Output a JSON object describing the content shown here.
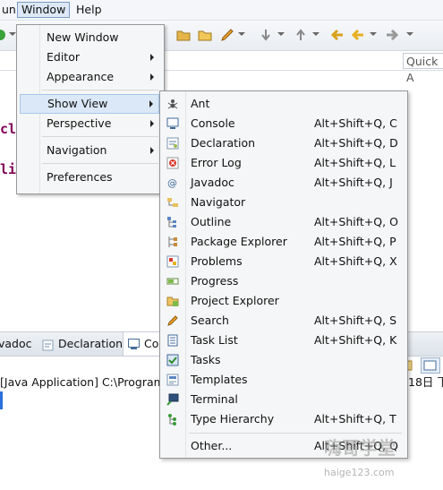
{
  "menubar": {
    "run_label": "un",
    "window_label": "Window",
    "help_label": "Help"
  },
  "toolbar": {
    "quick_access": "Quick A"
  },
  "editor": {
    "code_line1": "cl",
    "code_line2": "li"
  },
  "views": {
    "tab_javadoc": "vadoc",
    "tab_declaration": "Declaration",
    "tab_console": "Co",
    "console_text": "[Java Application] C:\\Program",
    "console_date": "18日 下"
  },
  "window_menu": {
    "items": [
      {
        "label": "New Window"
      },
      {
        "label": "Editor"
      },
      {
        "label": "Appearance"
      },
      {
        "label": "Show View"
      },
      {
        "label": "Perspective"
      },
      {
        "label": "Navigation"
      },
      {
        "label": "Preferences"
      }
    ]
  },
  "show_view_menu": {
    "items": [
      {
        "label": "Ant",
        "shortcut": "",
        "icon": "ant-icon"
      },
      {
        "label": "Console",
        "shortcut": "Alt+Shift+Q, C",
        "icon": "console-icon"
      },
      {
        "label": "Declaration",
        "shortcut": "Alt+Shift+Q, D",
        "icon": "declaration-icon"
      },
      {
        "label": "Error Log",
        "shortcut": "Alt+Shift+Q, L",
        "icon": "error-log-icon"
      },
      {
        "label": "Javadoc",
        "shortcut": "Alt+Shift+Q, J",
        "icon": "javadoc-icon"
      },
      {
        "label": "Navigator",
        "shortcut": "",
        "icon": "navigator-icon"
      },
      {
        "label": "Outline",
        "shortcut": "Alt+Shift+Q, O",
        "icon": "outline-icon"
      },
      {
        "label": "Package Explorer",
        "shortcut": "Alt+Shift+Q, P",
        "icon": "package-explorer-icon"
      },
      {
        "label": "Problems",
        "shortcut": "Alt+Shift+Q, X",
        "icon": "problems-icon"
      },
      {
        "label": "Progress",
        "shortcut": "",
        "icon": "progress-icon"
      },
      {
        "label": "Project Explorer",
        "shortcut": "",
        "icon": "project-explorer-icon"
      },
      {
        "label": "Search",
        "shortcut": "Alt+Shift+Q, S",
        "icon": "search-icon"
      },
      {
        "label": "Task List",
        "shortcut": "Alt+Shift+Q, K",
        "icon": "task-list-icon"
      },
      {
        "label": "Tasks",
        "shortcut": "",
        "icon": "tasks-icon"
      },
      {
        "label": "Templates",
        "shortcut": "",
        "icon": "templates-icon"
      },
      {
        "label": "Terminal",
        "shortcut": "",
        "icon": "terminal-icon"
      },
      {
        "label": "Type Hierarchy",
        "shortcut": "Alt+Shift+Q, T",
        "icon": "type-hierarchy-icon"
      },
      {
        "label": "Other...",
        "shortcut": "Alt+Shift+Q, Q",
        "icon": ""
      }
    ]
  },
  "watermark": {
    "text": "嗨哥学堂",
    "url": "haige123.com"
  }
}
